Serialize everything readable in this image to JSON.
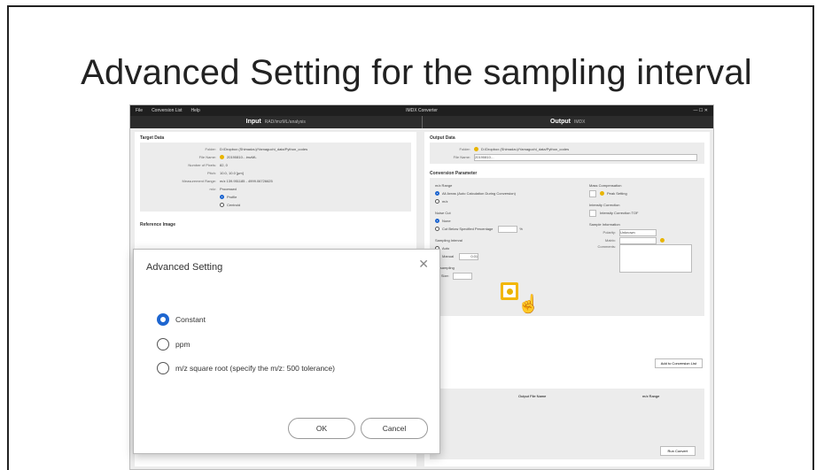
{
  "slide": {
    "title": "Advanced Setting for the sampling interval"
  },
  "app": {
    "menu": [
      "File",
      "Conversion List",
      "Help"
    ],
    "window_title": "IMDX Converter",
    "window_controls": "— ☐ ✕",
    "input_header": "Input",
    "input_header_sub": "RAD/imzML/analysis",
    "output_header": "Output",
    "output_header_sub": "IMDX",
    "target_data_title": "Target Data",
    "target_rows": [
      {
        "label": "Folder:",
        "value": "D:/Dropbox (Shimadzu)/Yamaguchi_data/Python_codes"
      },
      {
        "label": "File Name:",
        "value": "20190810…imzML"
      },
      {
        "label": "Number of Pixels:",
        "value": "82, 0"
      },
      {
        "label": "Pitch:",
        "value": "10.0, 10.0 [µm]"
      },
      {
        "label": "Measurement Range:",
        "value": "m/z 139.951185 - 4999.06726625"
      },
      {
        "label": "m/z:",
        "value": "Processed"
      }
    ],
    "target_mode": [
      "Profile",
      "Centroid"
    ],
    "reference_image_title": "Reference Image",
    "output_data_title": "Output Data",
    "output_rows": [
      {
        "label": "Folder:",
        "value": "D:/Dropbox (Shimadzu)/Yamaguchi_data/Python_codes"
      },
      {
        "label": "File Name:",
        "value": "20190810…"
      }
    ],
    "conversion_title": "Conversion Parameter",
    "mz_range_title": "m/z Range",
    "mz_range_opts": [
      "All Areas (Auto Calculation During Conversion)",
      "m/z"
    ],
    "noise_cut_title": "Noise Cut",
    "noise_cut_opts": [
      "None",
      "Cut Below Specified Percentage"
    ],
    "noise_unit": "%",
    "sampling_title": "Sampling Interval",
    "sampling_opts": [
      "Auto",
      "Manual"
    ],
    "sampling_value": "0.01",
    "binsampling_title": "Binsampling",
    "bin_size_label": "Bin Size:",
    "mass_comp_title": "Mass Compensation",
    "peak_setting": "Peak Setting",
    "intensity_corr_title": "Intensity Correction",
    "intensity_corr_opt": "Intensity Correction TOF",
    "sample_info_title": "Sample Information",
    "polarity_label": "Polarity:",
    "polarity_value": "Unknown",
    "matrix_label": "Matrix:",
    "comments_label": "Comments:",
    "add_to_list": "Add to Conversion List",
    "list_columns": [
      "Output File Name",
      "m/z Range"
    ],
    "run_convert": "Run Convert"
  },
  "dialog": {
    "title": "Advanced Setting",
    "close": "✕",
    "options": [
      {
        "label": "Constant",
        "selected": true
      },
      {
        "label": "ppm",
        "selected": false
      },
      {
        "label": "m/z square root (specify the m/z: 500 tolerance)",
        "selected": false
      }
    ],
    "ok_label": "OK",
    "cancel_label": "Cancel"
  },
  "colors": {
    "accent_blue": "#1e66d0",
    "highlight_yellow": "#f2b705",
    "header_dark": "#2c2c2c"
  }
}
